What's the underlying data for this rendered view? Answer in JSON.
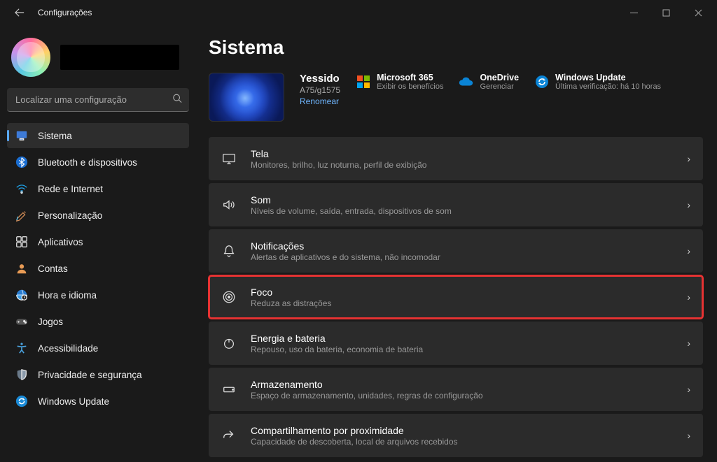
{
  "titlebar": {
    "title": "Configurações"
  },
  "search": {
    "placeholder": "Localizar uma configuração"
  },
  "nav": [
    {
      "key": "sistema",
      "label": "Sistema",
      "active": true
    },
    {
      "key": "bluetooth",
      "label": "Bluetooth e dispositivos",
      "active": false
    },
    {
      "key": "rede",
      "label": "Rede e Internet",
      "active": false
    },
    {
      "key": "personalizacao",
      "label": "Personalização",
      "active": false
    },
    {
      "key": "aplicativos",
      "label": "Aplicativos",
      "active": false
    },
    {
      "key": "contas",
      "label": "Contas",
      "active": false
    },
    {
      "key": "hora",
      "label": "Hora e idioma",
      "active": false
    },
    {
      "key": "jogos",
      "label": "Jogos",
      "active": false
    },
    {
      "key": "acessibilidade",
      "label": "Acessibilidade",
      "active": false
    },
    {
      "key": "privacidade",
      "label": "Privacidade e segurança",
      "active": false
    },
    {
      "key": "update",
      "label": "Windows Update",
      "active": false
    }
  ],
  "page": {
    "title": "Sistema"
  },
  "pc": {
    "name": "Yessido",
    "model": "A75/g1575",
    "rename": "Renomear"
  },
  "services": {
    "m365": {
      "title": "Microsoft 365",
      "sub": "Exibir os benefícios"
    },
    "onedrive": {
      "title": "OneDrive",
      "sub": "Gerenciar"
    },
    "update": {
      "title": "Windows Update",
      "sub": "Última verificação: há 10 horas"
    }
  },
  "rows": [
    {
      "key": "tela",
      "title": "Tela",
      "sub": "Monitores, brilho, luz noturna, perfil de exibição",
      "highlight": false
    },
    {
      "key": "som",
      "title": "Som",
      "sub": "Níveis de volume, saída, entrada, dispositivos de som",
      "highlight": false
    },
    {
      "key": "notificacoes",
      "title": "Notificações",
      "sub": "Alertas de aplicativos e do sistema, não incomodar",
      "highlight": false
    },
    {
      "key": "foco",
      "title": "Foco",
      "sub": "Reduza as distrações",
      "highlight": true
    },
    {
      "key": "energia",
      "title": "Energia e bateria",
      "sub": "Repouso, uso da bateria, economia de bateria",
      "highlight": false
    },
    {
      "key": "armazenamento",
      "title": "Armazenamento",
      "sub": "Espaço de armazenamento, unidades, regras de configuração",
      "highlight": false
    },
    {
      "key": "compartilhamento",
      "title": "Compartilhamento por proximidade",
      "sub": "Capacidade de descoberta, local de arquivos recebidos",
      "highlight": false
    }
  ]
}
